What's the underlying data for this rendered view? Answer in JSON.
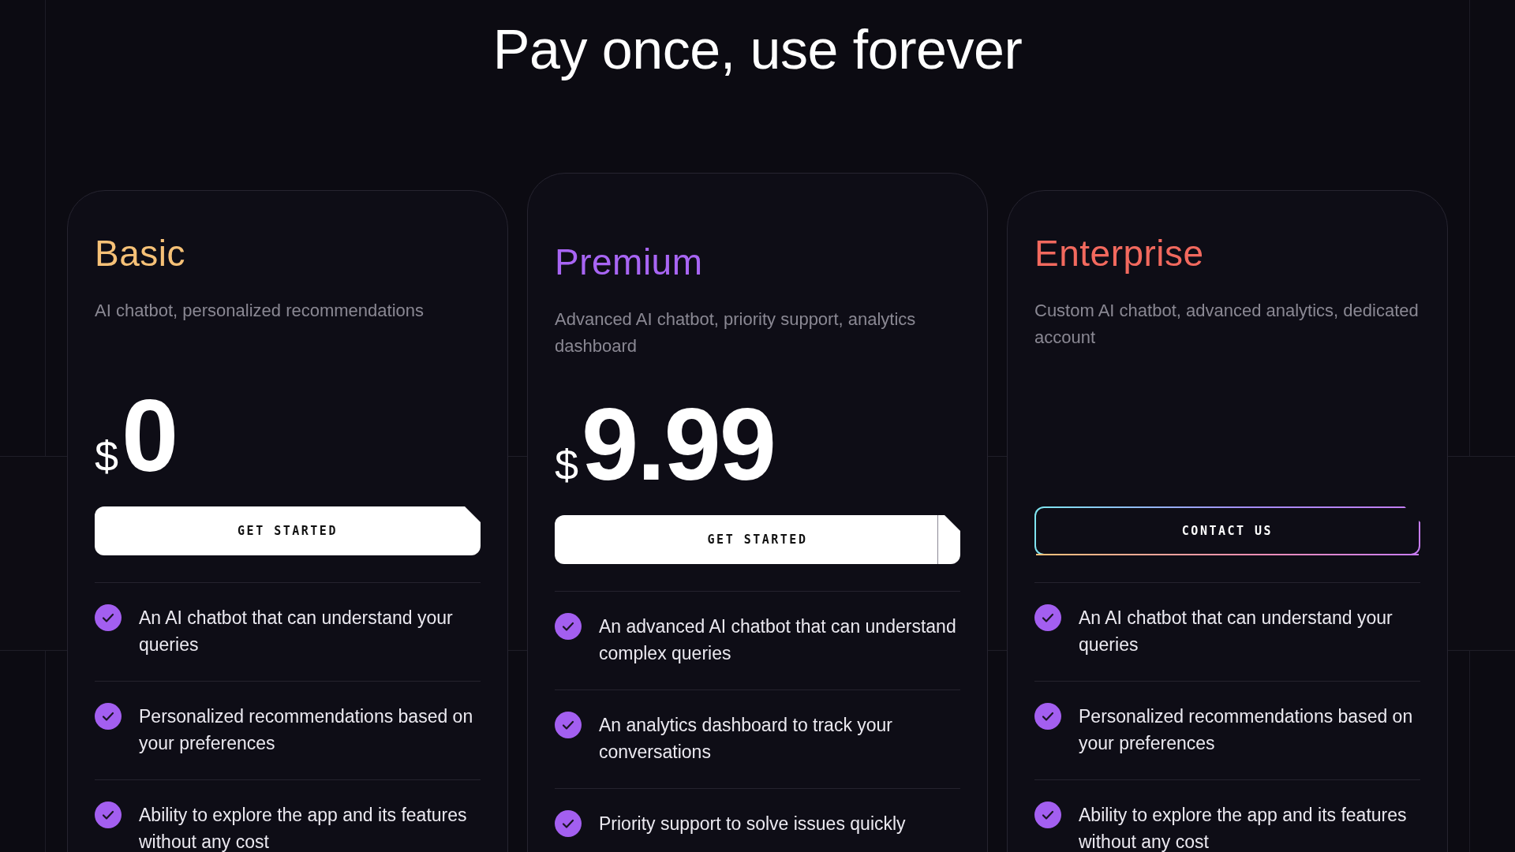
{
  "heading": "Pay once, use forever",
  "plans": [
    {
      "name": "Basic",
      "color": "#f6c177",
      "featured": false,
      "description": "AI chatbot, personalized recommendations",
      "price": {
        "currency": "$",
        "amount": "0"
      },
      "button": {
        "label": "GET STARTED",
        "kind": "solid"
      },
      "features": [
        "An AI chatbot that can understand your queries",
        "Personalized recommendations based on your preferences",
        "Ability to explore the app and its features without any cost"
      ]
    },
    {
      "name": "Premium",
      "color": "#a865f4",
      "featured": true,
      "description": "Advanced AI chatbot, priority support, analytics dashboard",
      "price": {
        "currency": "$",
        "amount": "9.99"
      },
      "button": {
        "label": "GET STARTED",
        "kind": "solid"
      },
      "features": [
        "An advanced AI chatbot that can understand complex queries",
        "An analytics dashboard to track your conversations",
        "Priority support to solve issues quickly"
      ]
    },
    {
      "name": "Enterprise",
      "color": "#f2695e",
      "featured": false,
      "description": "Custom AI chatbot, advanced analytics, dedicated account",
      "button": {
        "label": "CONTACT US",
        "kind": "outline"
      },
      "features": [
        "An AI chatbot that can understand your queries",
        "Personalized recommendations based on your preferences",
        "Ability to explore the app and its features without any cost"
      ]
    }
  ]
}
